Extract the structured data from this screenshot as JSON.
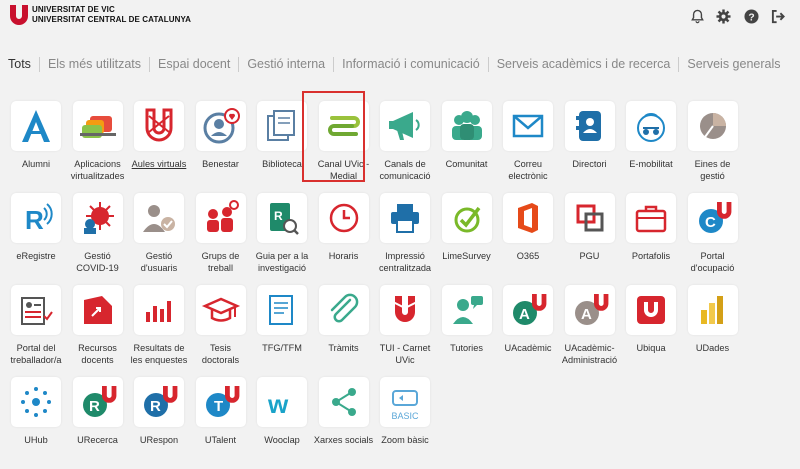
{
  "header": {
    "brand_line1": "UNIVERSITAT DE VIC",
    "brand_line2": "UNIVERSITAT CENTRAL DE CATALUNYA",
    "icons": [
      "bell-icon",
      "gear-icon",
      "help-icon",
      "logout-icon"
    ],
    "brand_color": "#c8102e"
  },
  "tabs": [
    {
      "label": "Tots",
      "active": true
    },
    {
      "label": "Els més utilitzats"
    },
    {
      "label": "Espai docent"
    },
    {
      "label": "Gestió interna"
    },
    {
      "label": "Informació i comunicació"
    },
    {
      "label": "Serveis acadèmics i de recerca"
    },
    {
      "label": "Serveis generals"
    }
  ],
  "apps": [
    {
      "label": "Alumni",
      "icon": "alumni-a-icon"
    },
    {
      "label": "Aplicacions virtualitzades",
      "icon": "virtual-apps-icon"
    },
    {
      "label": "Aules virtuals",
      "icon": "aules-virtuals-icon",
      "underline": true
    },
    {
      "label": "Benestar",
      "icon": "wellbeing-icon"
    },
    {
      "label": "Biblioteca",
      "icon": "library-icon"
    },
    {
      "label": "Canal UVic - Medial",
      "icon": "canal-uvic-icon",
      "highlighted": true
    },
    {
      "label": "Canals de comunicació",
      "icon": "megaphone-icon"
    },
    {
      "label": "Comunitat",
      "icon": "community-icon"
    },
    {
      "label": "Correu electrònic",
      "icon": "mail-icon"
    },
    {
      "label": "Directori",
      "icon": "directory-icon"
    },
    {
      "label": "E-mobilitat",
      "icon": "e-mobility-icon"
    },
    {
      "label": "Eines de gestió",
      "icon": "management-tools-icon"
    },
    {
      "label": "eRegistre",
      "icon": "eregistre-icon"
    },
    {
      "label": "Gestió COVID-19",
      "icon": "covid-icon"
    },
    {
      "label": "Gestió d'usuaris",
      "icon": "user-management-icon"
    },
    {
      "label": "Grups de treball",
      "icon": "workgroups-icon"
    },
    {
      "label": "Guia per a la investigació",
      "icon": "research-guide-icon"
    },
    {
      "label": "Horaris",
      "icon": "clock-icon"
    },
    {
      "label": "Impressió centralitzada",
      "icon": "printer-icon"
    },
    {
      "label": "LimeSurvey",
      "icon": "limesurvey-icon"
    },
    {
      "label": "O365",
      "icon": "office365-icon"
    },
    {
      "label": "PGU",
      "icon": "pgu-icon"
    },
    {
      "label": "Portafolis",
      "icon": "briefcase-icon"
    },
    {
      "label": "Portal d'ocupació",
      "icon": "job-portal-icon"
    },
    {
      "label": "Portal del treballador/a",
      "icon": "worker-portal-icon"
    },
    {
      "label": "Recursos docents",
      "icon": "teaching-resources-icon"
    },
    {
      "label": "Resultats de les enquestes",
      "icon": "survey-results-icon"
    },
    {
      "label": "Tesis doctorals",
      "icon": "graduation-cap-icon"
    },
    {
      "label": "TFG/TFM",
      "icon": "tfg-tfm-icon"
    },
    {
      "label": "Tràmits",
      "icon": "paperclip-icon"
    },
    {
      "label": "TUI - Carnet UVic",
      "icon": "tui-card-icon"
    },
    {
      "label": "Tutories",
      "icon": "tutoring-icon"
    },
    {
      "label": "UAcadèmic",
      "icon": "uacademic-icon"
    },
    {
      "label": "UAcadèmic-Administració",
      "icon": "uacademic-admin-icon"
    },
    {
      "label": "Ubiqua",
      "icon": "ubiqua-icon"
    },
    {
      "label": "UDades",
      "icon": "udades-icon"
    },
    {
      "label": "UHub",
      "icon": "uhub-icon"
    },
    {
      "label": "URecerca",
      "icon": "urecerca-icon"
    },
    {
      "label": "URespon",
      "icon": "urespon-icon"
    },
    {
      "label": "UTalent",
      "icon": "utalent-icon"
    },
    {
      "label": "Wooclap",
      "icon": "wooclap-icon"
    },
    {
      "label": "Xarxes socials",
      "icon": "share-icon"
    },
    {
      "label": "Zoom bàsic",
      "icon": "zoom-basic-icon",
      "icon_text": "BASIC"
    }
  ]
}
